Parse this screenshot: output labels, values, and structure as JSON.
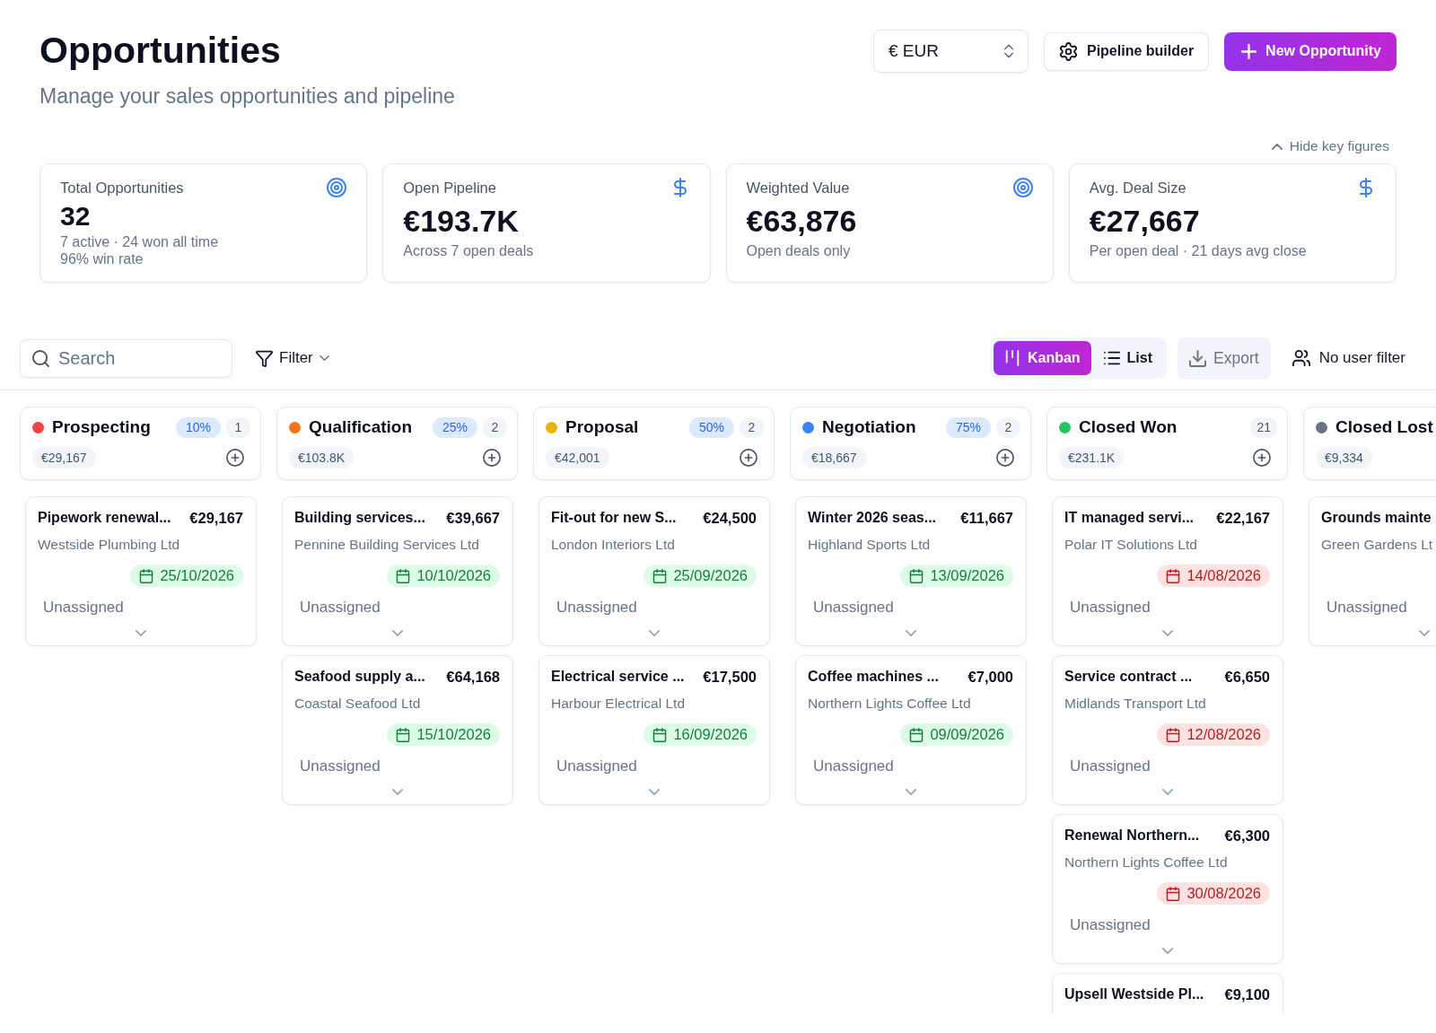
{
  "header": {
    "title": "Opportunities",
    "subtitle": "Manage your sales opportunities and pipeline"
  },
  "actions": {
    "currency": "€ EUR",
    "pipeline_builder": "Pipeline builder",
    "new_opportunity": "New Opportunity"
  },
  "key_figures": {
    "toggle": "Hide key figures",
    "expanded": true,
    "cards": [
      {
        "label": "Total Opportunities",
        "value": "32",
        "notes": [
          "7 active · 24 won all time",
          "96% win rate"
        ]
      },
      {
        "label": "Open Pipeline",
        "value": "€193.7K",
        "notes": [
          "Across 7 open deals"
        ]
      },
      {
        "label": "Weighted Value",
        "value": "€63,876",
        "notes": [
          "Open deals only"
        ]
      },
      {
        "label": "Avg. Deal Size",
        "value": "€27,667",
        "notes": [
          "Per open deal · 21 days avg close"
        ]
      }
    ]
  },
  "toolbar": {
    "search": {
      "placeholder": "Search"
    },
    "filter": "Filter",
    "views": [
      {
        "label": "Kanban",
        "selected": true
      },
      {
        "label": "List",
        "selected": false
      }
    ],
    "export": {
      "label": "Export",
      "disabled": true
    },
    "user_filter": "No user filter"
  },
  "board": {
    "columns": [
      {
        "name": "Prospecting",
        "color": "#ef4444",
        "probability": "10%",
        "count": "1",
        "total": "€29,167",
        "deals": [
          {
            "title": "Pipework renewal...",
            "amount": "€29,167",
            "company": "Westside Plumbing Ltd",
            "due": "25/10/2026",
            "overdue": false,
            "assignee": "Unassigned"
          }
        ]
      },
      {
        "name": "Qualification",
        "color": "#f97316",
        "probability": "25%",
        "count": "2",
        "total": "€103.8K",
        "deals": [
          {
            "title": "Building services...",
            "amount": "€39,667",
            "company": "Pennine Building Services Ltd",
            "due": "10/10/2026",
            "overdue": false,
            "assignee": "Unassigned"
          },
          {
            "title": "Seafood supply a...",
            "amount": "€64,168",
            "company": "Coastal Seafood Ltd",
            "due": "15/10/2026",
            "overdue": false,
            "assignee": "Unassigned"
          }
        ]
      },
      {
        "name": "Proposal",
        "color": "#eab308",
        "probability": "50%",
        "count": "2",
        "total": "€42,001",
        "deals": [
          {
            "title": "Fit-out for new S...",
            "amount": "€24,500",
            "company": "London Interiors Ltd",
            "due": "25/09/2026",
            "overdue": false,
            "assignee": "Unassigned"
          },
          {
            "title": "Electrical service ...",
            "amount": "€17,500",
            "company": "Harbour Electrical Ltd",
            "due": "16/09/2026",
            "overdue": false,
            "assignee": "Unassigned"
          }
        ]
      },
      {
        "name": "Negotiation",
        "color": "#3b82f6",
        "probability": "75%",
        "count": "2",
        "total": "€18,667",
        "deals": [
          {
            "title": "Winter 2026 seas...",
            "amount": "€11,667",
            "company": "Highland Sports Ltd",
            "due": "13/09/2026",
            "overdue": false,
            "assignee": "Unassigned"
          },
          {
            "title": "Coffee machines ...",
            "amount": "€7,000",
            "company": "Northern Lights Coffee Ltd",
            "due": "09/09/2026",
            "overdue": false,
            "assignee": "Unassigned"
          }
        ]
      },
      {
        "name": "Closed Won",
        "color": "#22c55e",
        "count": "21",
        "total": "€231.1K",
        "deals": [
          {
            "title": "IT managed servi...",
            "amount": "€22,167",
            "company": "Polar IT Solutions Ltd",
            "due": "14/08/2026",
            "overdue": true,
            "assignee": "Unassigned"
          },
          {
            "title": "Service contract ...",
            "amount": "€6,650",
            "company": "Midlands Transport Ltd",
            "due": "12/08/2026",
            "overdue": true,
            "assignee": "Unassigned"
          },
          {
            "title": "Renewal Northern...",
            "amount": "€6,300",
            "company": "Northern Lights Coffee Ltd",
            "due": "30/08/2026",
            "overdue": true,
            "assignee": "Unassigned"
          },
          {
            "title": "Upsell Westside Pl...",
            "amount": "€9,100"
          }
        ]
      },
      {
        "name": "Closed Lost",
        "color": "#6b7280",
        "total": "€9,334",
        "deals": [
          {
            "title": "Grounds mainte",
            "company": "Green Gardens Lt",
            "assignee": "Unassigned"
          }
        ]
      }
    ]
  }
}
